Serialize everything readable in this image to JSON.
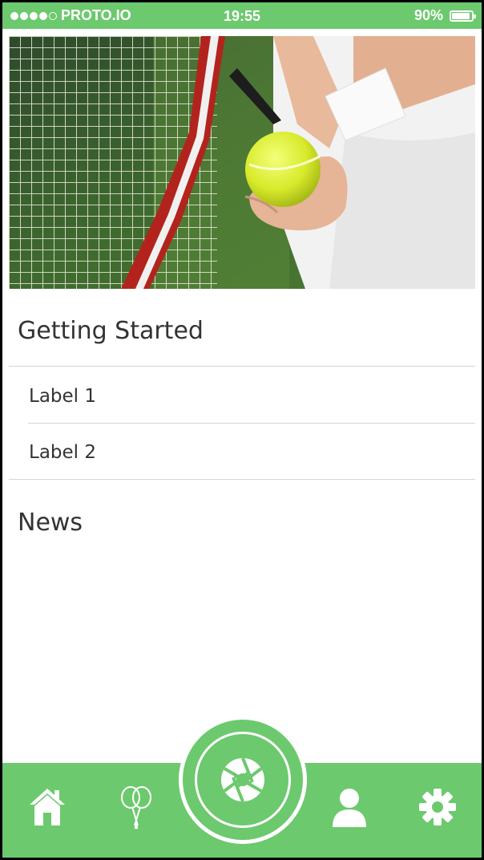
{
  "status_bar": {
    "carrier": "PROTO.IO",
    "time": "19:55",
    "battery": "90%",
    "signal_filled": 4,
    "signal_total": 5
  },
  "hero": {
    "image": "tennis-player-holding-ball-and-racket"
  },
  "sections": [
    {
      "title": "Getting Started",
      "items": [
        "Label 1",
        "Label 2"
      ]
    },
    {
      "title": "News",
      "items": []
    }
  ],
  "tabbar": {
    "tabs": [
      {
        "icon": "home-icon"
      },
      {
        "icon": "tennis-rackets-icon"
      },
      {
        "icon": "camera-aperture-icon"
      },
      {
        "icon": "user-icon"
      },
      {
        "icon": "gear-icon"
      }
    ]
  },
  "colors": {
    "accent": "#6cc96e",
    "text": "#333333",
    "divider": "#cfd9cf",
    "background": "#ffffff"
  }
}
